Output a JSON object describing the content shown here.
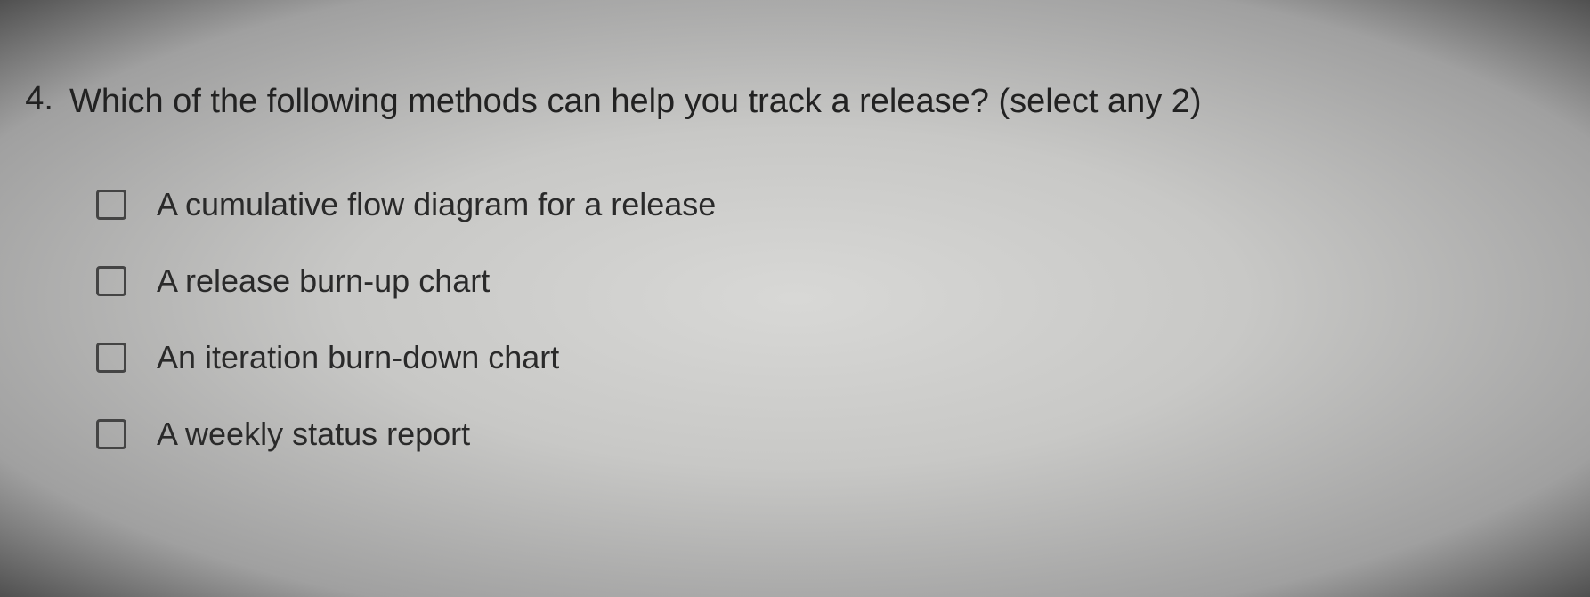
{
  "question": {
    "number": "4.",
    "text": "Which of the following methods can help you track a release? (select any 2)"
  },
  "options": [
    {
      "label": "A cumulative flow diagram for a release"
    },
    {
      "label": "A release burn-up chart"
    },
    {
      "label": "An iteration burn-down chart"
    },
    {
      "label": "A weekly status report"
    }
  ]
}
